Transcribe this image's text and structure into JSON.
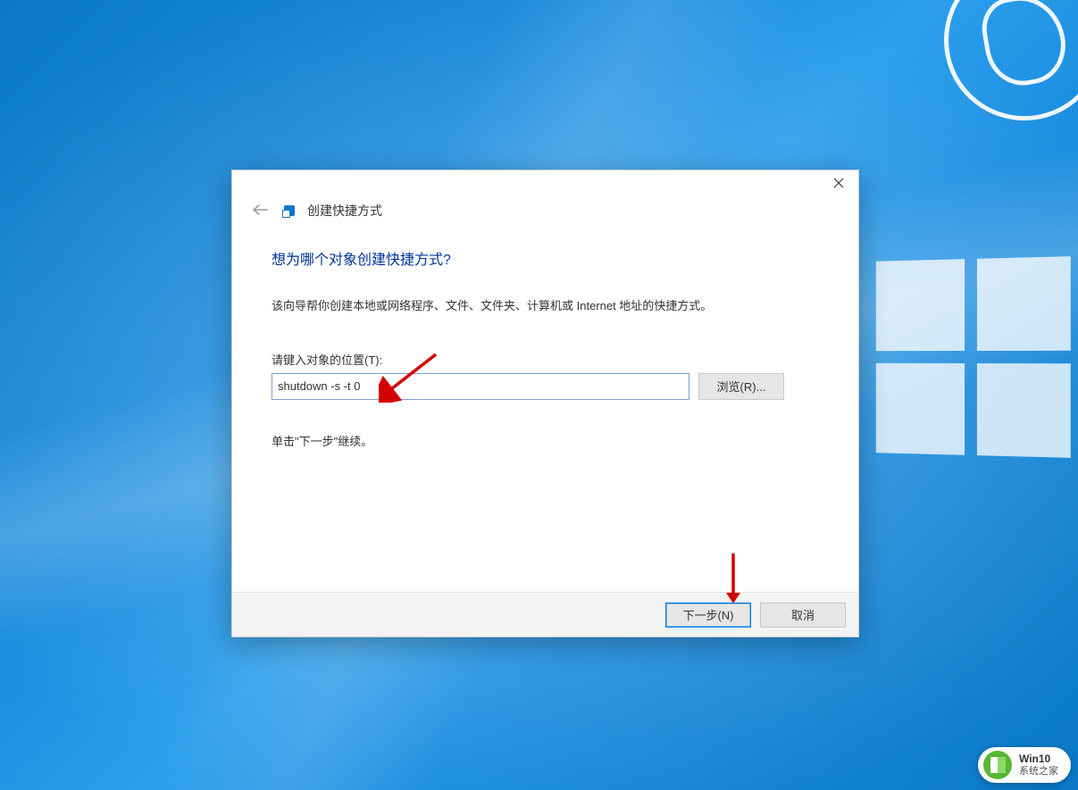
{
  "dialog": {
    "header_title": "创建快捷方式",
    "question": "想为哪个对象创建快捷方式?",
    "description": "该向导帮你创建本地或网络程序、文件、文件夹、计算机或 Internet 地址的快捷方式。",
    "input_label": "请键入对象的位置(T):",
    "input_value": "shutdown -s -t 0",
    "browse_label": "浏览(R)...",
    "continue_text": "单击\"下一步\"继续。",
    "next_label": "下一步(N)",
    "cancel_label": "取消"
  },
  "brand": {
    "line1": "Win10",
    "line2": "系统之家"
  },
  "colors": {
    "accent": "#0078d7",
    "heading": "#003399",
    "arrow": "#d40000"
  }
}
